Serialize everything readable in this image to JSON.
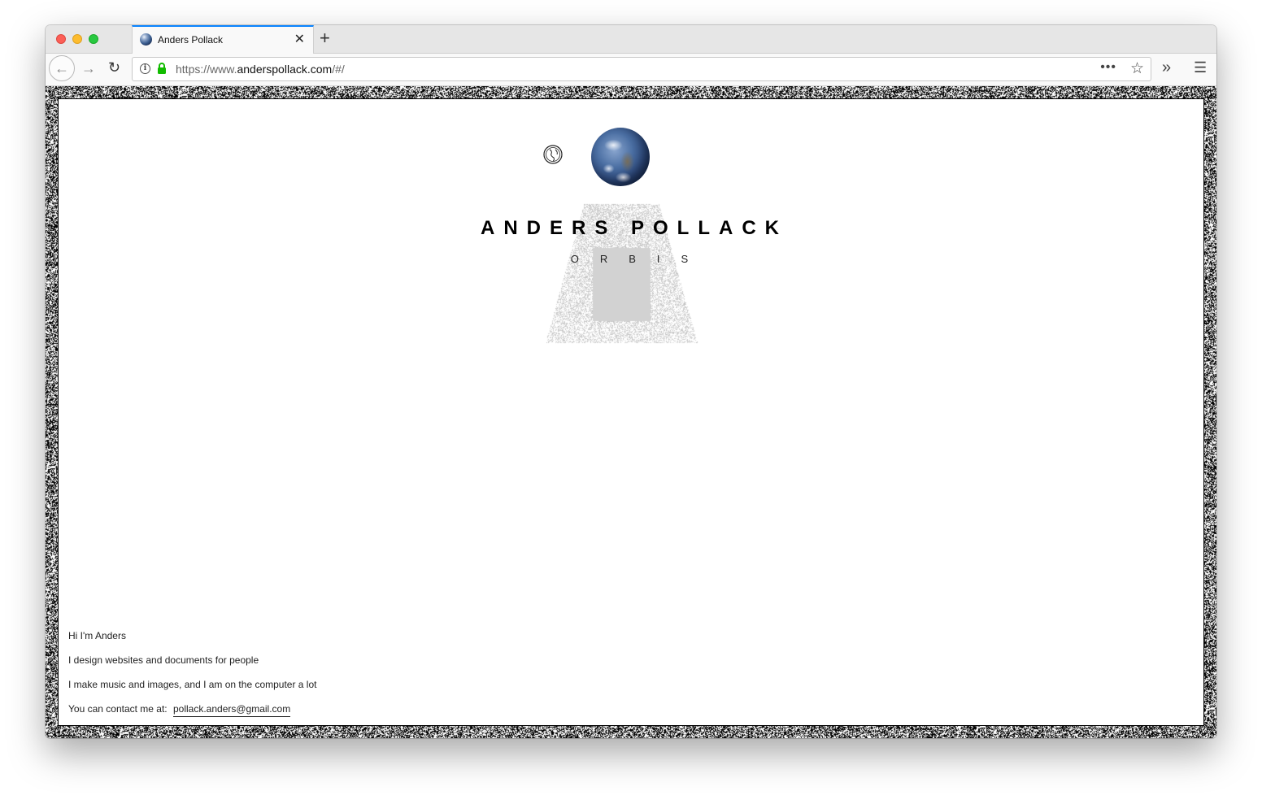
{
  "browser": {
    "tab": {
      "title": "Anders Pollack",
      "close_glyph": "✕",
      "favicon": "earth-favicon"
    },
    "new_tab_glyph": "+",
    "nav": {
      "back_glyph": "←",
      "forward_glyph": "→",
      "reload_glyph": "↻"
    },
    "url": {
      "prefix": "https://www.",
      "domain": "anderspollack.com",
      "path": "/#/"
    },
    "page_actions_glyph": "•••",
    "bookmark_glyph": "☆",
    "overflow_glyph": "»",
    "menu_glyph": "☰",
    "icons": [
      "info-icon",
      "lock-icon",
      "page-actions-icon",
      "star-icon",
      "overflow-icon",
      "hamburger-menu-icon"
    ]
  },
  "page": {
    "title": "ANDERS POLLACK",
    "subtitle": "ORBIS",
    "bio": {
      "line1": "Hi I'm Anders",
      "line2": "I design websites and documents for people",
      "line3": "I make music and images, and I am on the computer a lot",
      "contact_label": "You can contact me at:",
      "email": "pollack.anders@gmail.com"
    },
    "colors": {
      "accent_tab": "#0a84ff",
      "lock_green": "#12bc00",
      "text": "#000000"
    }
  }
}
